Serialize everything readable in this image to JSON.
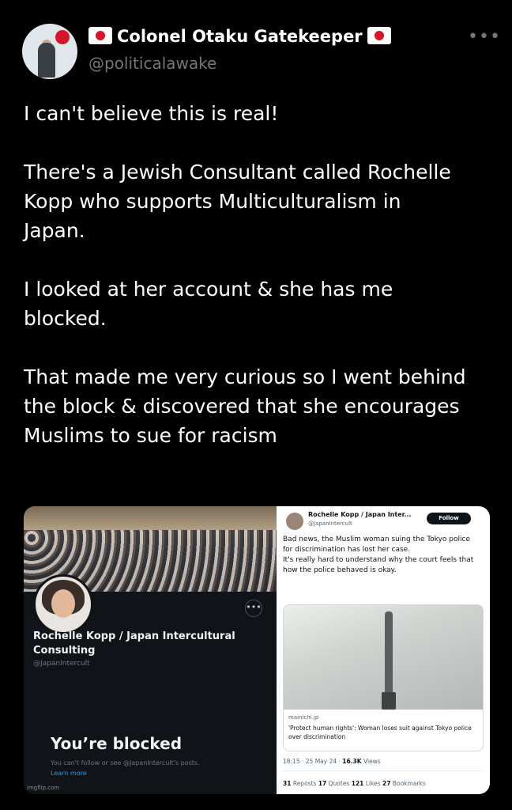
{
  "author": {
    "name": "Colonel Otaku Gatekeeper",
    "handle": "@politicalawake"
  },
  "tweet": {
    "paragraphs": [
      "I can't believe this is real!",
      "There's a Jewish Consultant called Rochelle\nKopp who supports Multiculturalism in\nJapan.",
      " I looked at her account & she has me\nblocked.",
      "That made me very curious so I went behind\nthe block & discovered that she encourages\nMuslims to sue for racism"
    ]
  },
  "media": {
    "profile": {
      "name": "Rochelle Kopp / Japan Intercultural Consulting",
      "handle": "@JapanIntercult",
      "blocked_title": "You’re blocked",
      "blocked_sub": "You can't follow or see @JapanIntercult's posts.",
      "learn_more": "Learn more",
      "watermark": "imgflip.com"
    },
    "post": {
      "name": "Rochelle Kopp / Japan Inter...",
      "handle": "@JapanIntercult",
      "follow": "Follow",
      "text1": "Bad news, the Muslim woman suing the Tokyo police for discrimination has lost her case.",
      "text2": "It's really hard to understand why the court feels that how the police behaved is okay.",
      "card_domain": "mainichi.jp",
      "card_title": "'Protect human rights': Woman loses suit against Tokyo police over discrimination",
      "time": "18:15 · 25 May 24 · ",
      "views_count": "16.3K",
      "views_label": " Views",
      "reposts": "31",
      "reposts_label": " Reposts  ",
      "quotes": "17",
      "quotes_label": " Quotes  ",
      "likes": "121",
      "likes_label": " Likes  ",
      "bookmarks": "27",
      "bookmarks_label": " Bookmarks"
    }
  }
}
